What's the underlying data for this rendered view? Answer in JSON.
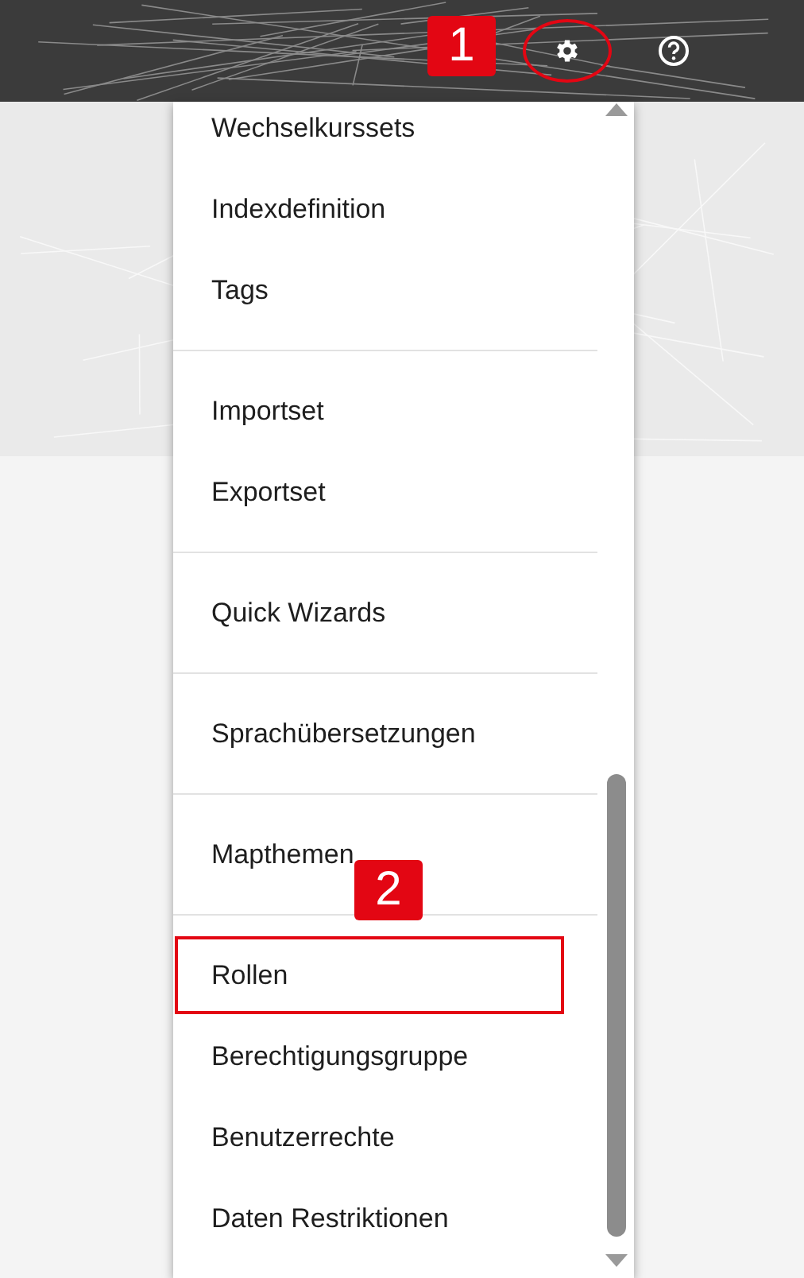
{
  "toolbar": {
    "callout": "1",
    "buttons": [
      {
        "kind": "settings",
        "circled": true
      },
      {
        "kind": "help",
        "circled": false
      }
    ]
  },
  "menu": {
    "callout": "2",
    "groups": [
      {
        "items": [
          {
            "label": "Wechselkurssets",
            "highlighted": false
          },
          {
            "label": "Indexdefinition",
            "highlighted": false
          },
          {
            "label": "Tags",
            "highlighted": false
          }
        ]
      },
      {
        "items": [
          {
            "label": "Importset",
            "highlighted": false
          },
          {
            "label": "Exportset",
            "highlighted": false
          }
        ]
      },
      {
        "items": [
          {
            "label": "Quick Wizards",
            "highlighted": false
          }
        ]
      },
      {
        "items": [
          {
            "label": "Sprachübersetzungen",
            "highlighted": false
          }
        ]
      },
      {
        "items": [
          {
            "label": "Mapthemen",
            "highlighted": false
          }
        ]
      },
      {
        "items": [
          {
            "label": "Rollen",
            "highlighted": true
          },
          {
            "label": "Berechtigungsgruppe",
            "highlighted": false
          },
          {
            "label": "Benutzerrechte",
            "highlighted": false
          },
          {
            "label": "Daten Restriktionen",
            "highlighted": false
          }
        ]
      }
    ]
  }
}
